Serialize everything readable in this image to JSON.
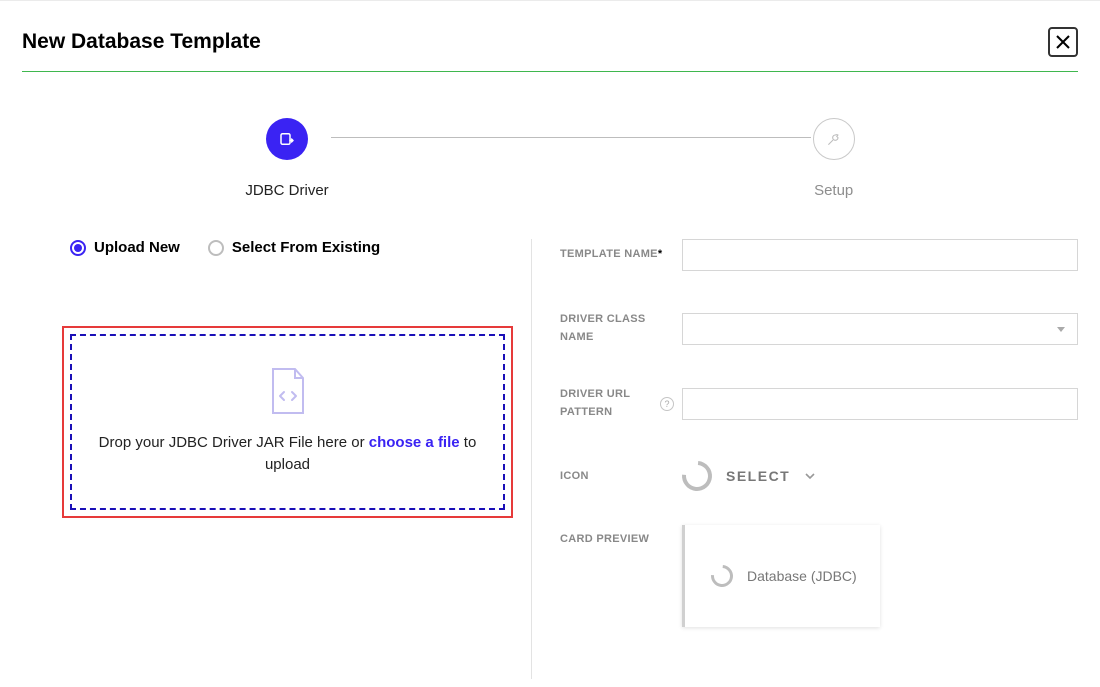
{
  "title": "New Database Template",
  "stepper": {
    "step1_label": "JDBC Driver",
    "step2_label": "Setup"
  },
  "radios": {
    "upload_new": "Upload New",
    "select_existing": "Select From Existing"
  },
  "dropzone": {
    "prefix": "Drop your JDBC Driver JAR File here or ",
    "choose": "choose a file",
    "suffix": " to upload"
  },
  "form": {
    "template_name_label": "TEMPLATE NAME",
    "required": "*",
    "driver_class_label": "DRIVER CLASS NAME",
    "driver_url_label": "DRIVER URL PATTERN",
    "icon_label": "ICON",
    "icon_select": "SELECT",
    "card_preview_label": "CARD PREVIEW",
    "card_preview_text": "Database (JDBC)"
  }
}
